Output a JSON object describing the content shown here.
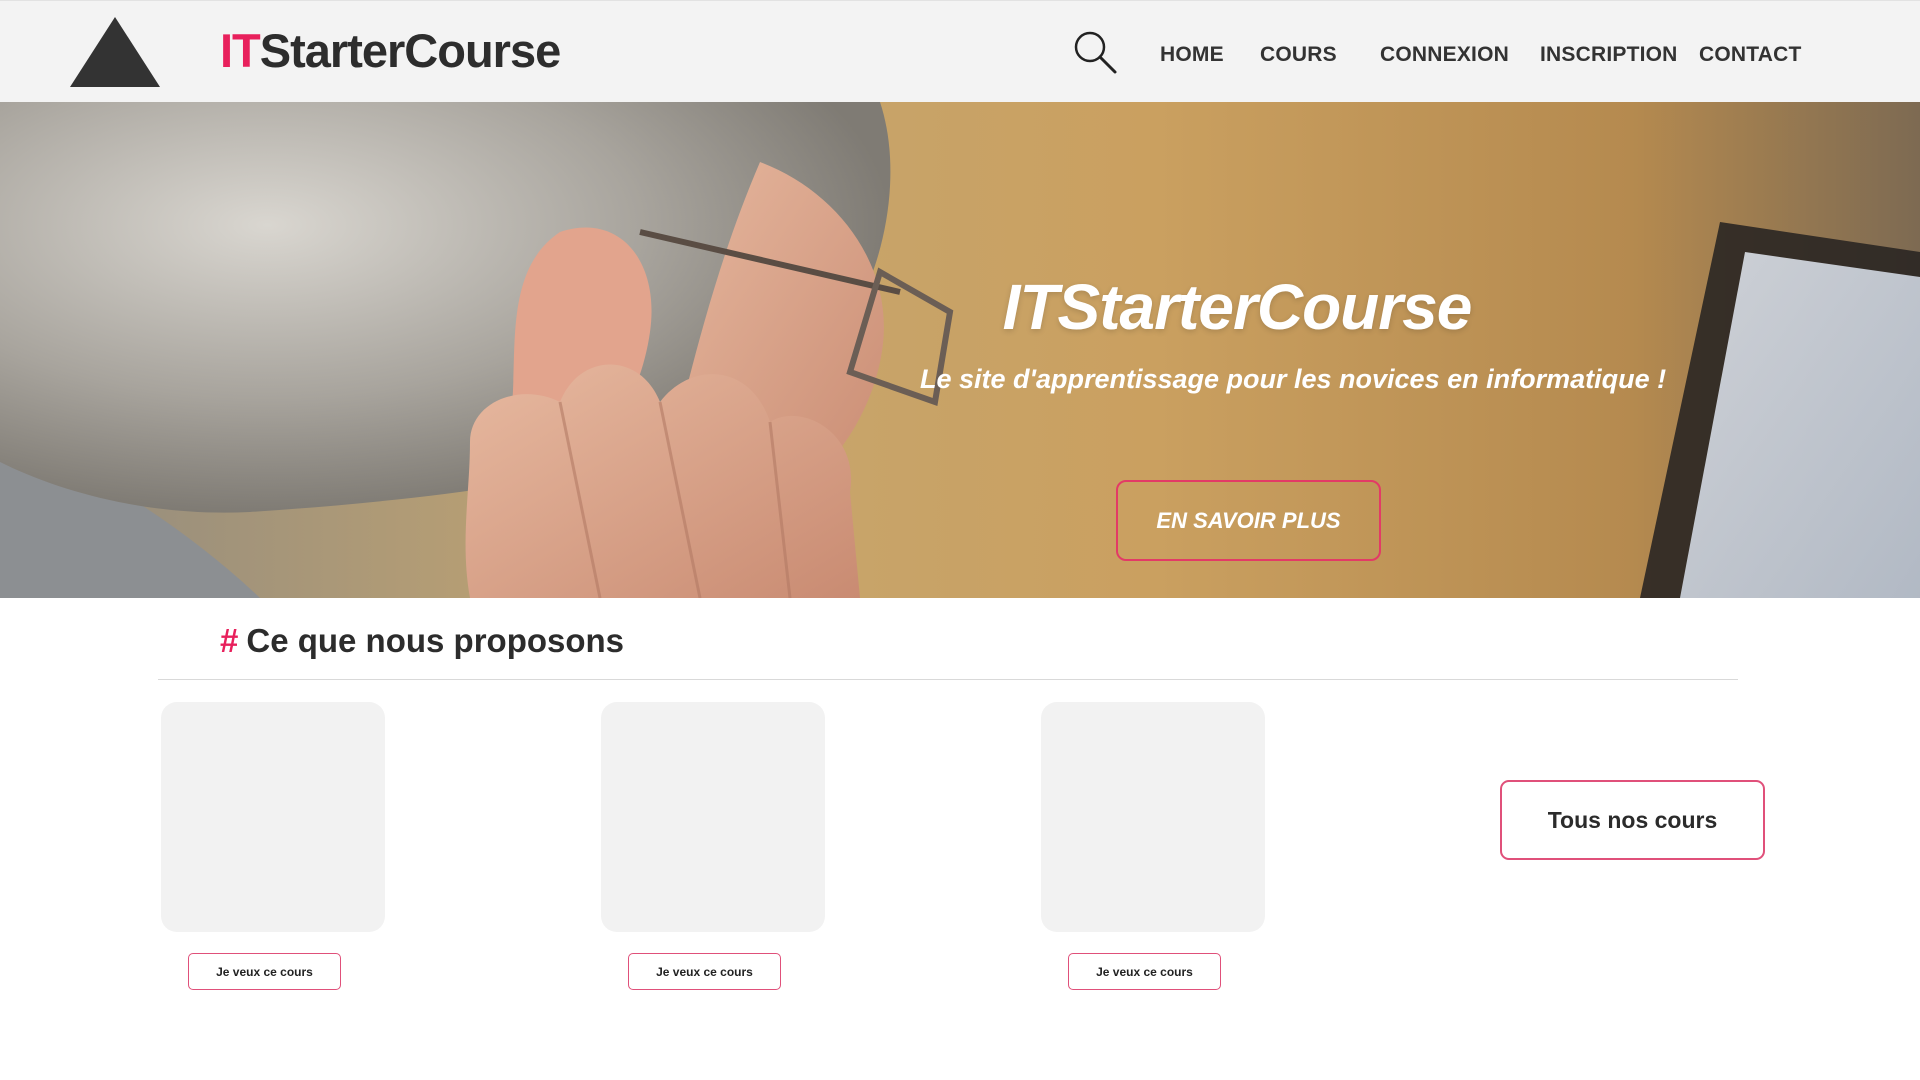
{
  "header": {
    "logo_icon": "triangle-logo-icon",
    "brand_accent": "IT",
    "brand_rest": "StarterCourse",
    "search_icon": "search-icon",
    "nav": [
      "HOME",
      "COURS",
      "CONNEXION",
      "INSCRIPTION",
      "CONTACT"
    ]
  },
  "hero": {
    "title": "ITStarterCourse",
    "subtitle": "Le site d'apprentissage pour les novices en informatique  !",
    "button_label": "EN SAVOIR PLUS"
  },
  "offers": {
    "hash": "#",
    "title": "Ce que nous proposons",
    "cards": [
      {
        "button_label": "Je veux ce cours"
      },
      {
        "button_label": "Je veux ce cours"
      },
      {
        "button_label": "Je veux ce cours"
      }
    ],
    "all_courses_label": "Tous nos cours"
  },
  "colors": {
    "accent": "#e8205c",
    "header_bg": "#f3f3f3",
    "card_bg": "#f2f2f2",
    "text": "#2d2d2d"
  }
}
